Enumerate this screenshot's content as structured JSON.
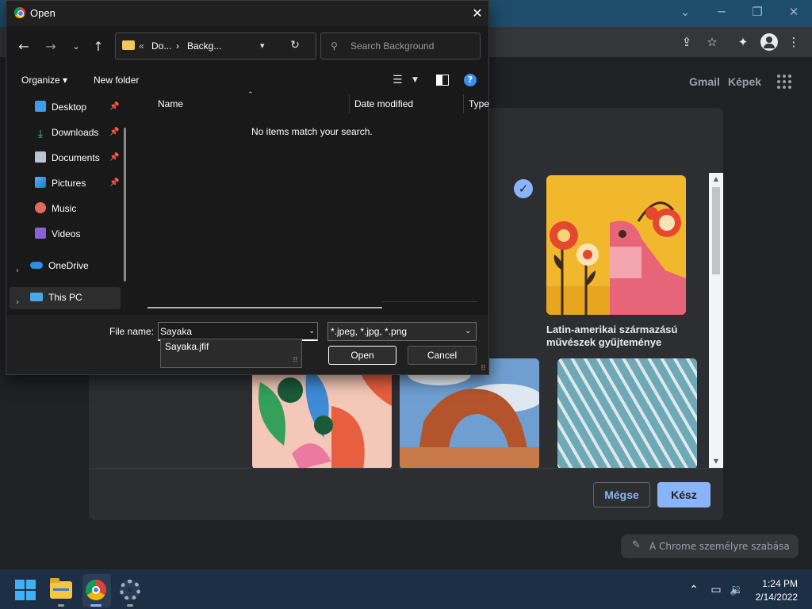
{
  "chrome": {
    "gmail_link": "Gmail",
    "images_link": "Képek",
    "thumb_caption": "Latin-amerikai származású művészek gyűjteménye",
    "cancel_label": "Mégse",
    "done_label": "Kész",
    "customize_chip": "A Chrome személyre szabása",
    "accent_color": "#8ab4f8"
  },
  "dialog": {
    "title": "Open",
    "address": {
      "overflow": "«",
      "segment1": "Do...",
      "separator": "›",
      "segment2": "Backg..."
    },
    "search_placeholder": "Search Background",
    "toolbar": {
      "organize": "Organize ▾",
      "new_folder": "New folder"
    },
    "nav": {
      "desktop": "Desktop",
      "downloads": "Downloads",
      "documents": "Documents",
      "pictures": "Pictures",
      "music": "Music",
      "videos": "Videos",
      "onedrive": "OneDrive",
      "this_pc": "This PC"
    },
    "columns": {
      "name": "Name",
      "date_modified": "Date modified",
      "type": "Type"
    },
    "empty_message": "No items match your search.",
    "file_name_label": "File name:",
    "file_name_value": "Sayaka",
    "suggestion": "Sayaka.jfif",
    "file_type": "*.jpeg, *.jpg, *.png",
    "open_label": "Open",
    "cancel_label": "Cancel"
  },
  "taskbar": {
    "time": "1:24 PM",
    "date": "2/14/2022"
  }
}
